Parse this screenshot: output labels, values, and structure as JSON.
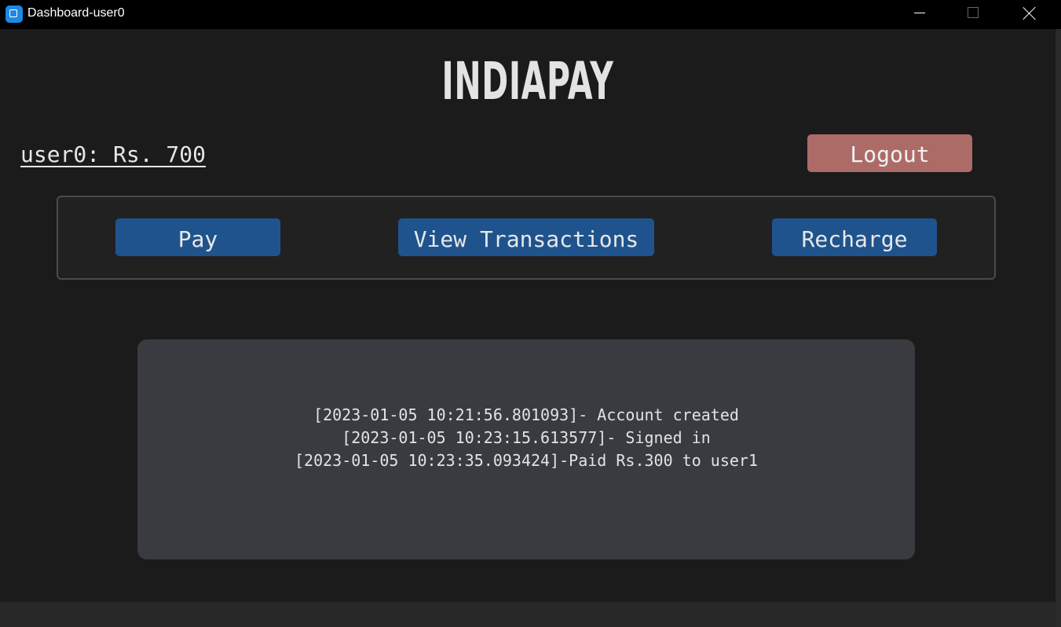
{
  "window": {
    "title": "Dashboard-user0"
  },
  "header": {
    "brand": "INDIAPAY"
  },
  "account": {
    "balance_label": "user0: Rs. 700"
  },
  "buttons": {
    "logout": "Logout",
    "pay": "Pay",
    "view_transactions": "View Transactions",
    "recharge": "Recharge"
  },
  "log": {
    "lines": [
      "[2023-01-05 10:21:56.801093]- Account created",
      "[2023-01-05 10:23:15.613577]- Signed in",
      "[2023-01-05 10:23:35.093424]-Paid Rs.300 to user1"
    ]
  },
  "colors": {
    "background": "#1b1b1b",
    "primary_button": "#1f538d",
    "logout_button": "#ad6b68",
    "log_panel": "#393b40"
  }
}
